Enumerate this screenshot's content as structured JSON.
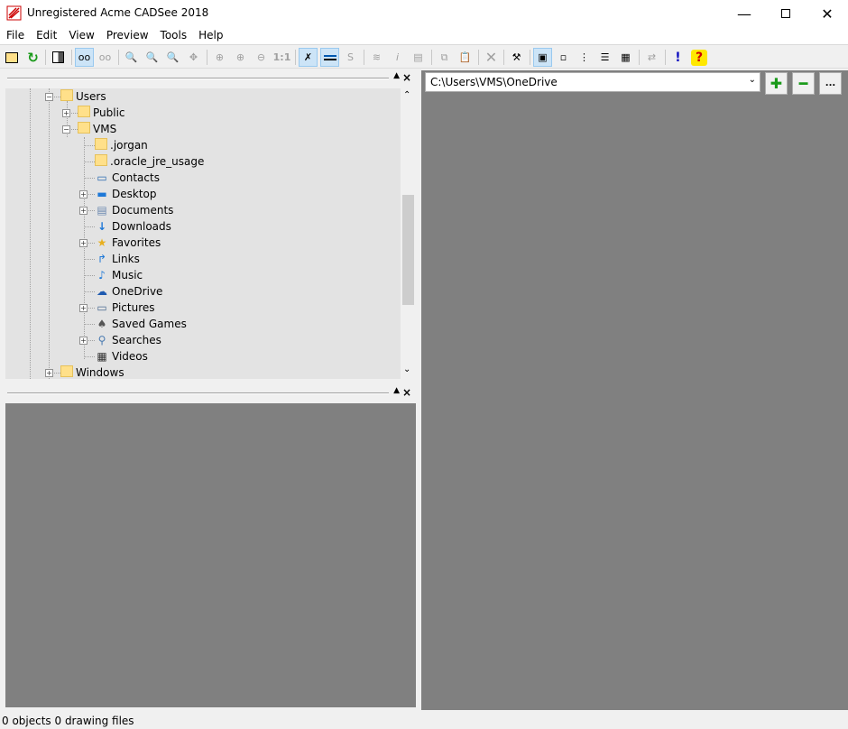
{
  "window": {
    "title": "Unregistered Acme CADSee 2018"
  },
  "menu": [
    "File",
    "Edit",
    "View",
    "Preview",
    "Tools",
    "Help"
  ],
  "tree": {
    "items": [
      {
        "label": "Users",
        "level": 0,
        "icon": "folder-icon",
        "expander": "minus"
      },
      {
        "label": "Public",
        "level": 1,
        "icon": "folder-icon",
        "expander": "plus"
      },
      {
        "label": "VMS",
        "level": 1,
        "icon": "folder-icon",
        "expander": "minus"
      },
      {
        "label": ".jorgan",
        "level": 2,
        "icon": "folder-icon",
        "expander": ""
      },
      {
        "label": ".oracle_jre_usage",
        "level": 2,
        "icon": "folder-icon",
        "expander": ""
      },
      {
        "label": "Contacts",
        "level": 2,
        "icon": "contacts-icon",
        "expander": ""
      },
      {
        "label": "Desktop",
        "level": 2,
        "icon": "desktop-icon",
        "expander": "plus"
      },
      {
        "label": "Documents",
        "level": 2,
        "icon": "documents-icon",
        "expander": "plus"
      },
      {
        "label": "Downloads",
        "level": 2,
        "icon": "downloads-icon",
        "expander": ""
      },
      {
        "label": "Favorites",
        "level": 2,
        "icon": "favorites-icon",
        "expander": "plus"
      },
      {
        "label": "Links",
        "level": 2,
        "icon": "links-icon",
        "expander": ""
      },
      {
        "label": "Music",
        "level": 2,
        "icon": "music-icon",
        "expander": ""
      },
      {
        "label": "OneDrive",
        "level": 2,
        "icon": "onedrive-icon",
        "expander": ""
      },
      {
        "label": "Pictures",
        "level": 2,
        "icon": "pictures-icon",
        "expander": "plus"
      },
      {
        "label": "Saved Games",
        "level": 2,
        "icon": "saved-games-icon",
        "expander": ""
      },
      {
        "label": "Searches",
        "level": 2,
        "icon": "searches-icon",
        "expander": "plus"
      },
      {
        "label": "Videos",
        "level": 2,
        "icon": "videos-icon",
        "expander": ""
      },
      {
        "label": "Windows",
        "level": 0,
        "icon": "folder-icon",
        "expander": "plus"
      }
    ]
  },
  "path": {
    "value": "C:\\Users\\VMS\\OneDrive"
  },
  "status": {
    "text": "0 objects 0 drawing files"
  },
  "colors": {
    "panel_gray": "#808080",
    "tree_bg": "#e3e3e3",
    "folder": "#ffe08a"
  }
}
